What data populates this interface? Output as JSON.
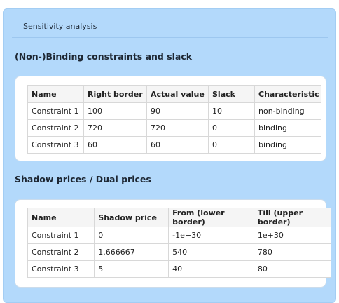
{
  "panel": {
    "title": "Sensitivity analysis"
  },
  "binding": {
    "title": "(Non-)Binding constraints and slack",
    "headers": [
      "Name",
      "Right border",
      "Actual value",
      "Slack",
      "Characteristic"
    ],
    "rows": [
      [
        "Constraint 1",
        "100",
        "90",
        "10",
        "non-binding"
      ],
      [
        "Constraint 2",
        "720",
        "720",
        "0",
        "binding"
      ],
      [
        "Constraint 3",
        "60",
        "60",
        "0",
        "binding"
      ]
    ]
  },
  "shadow": {
    "title": "Shadow prices / Dual prices",
    "headers": [
      "Name",
      "Shadow price",
      "From (lower border)",
      "Till (upper border)"
    ],
    "rows": [
      [
        "Constraint 1",
        "0",
        "-1e+30",
        "1e+30"
      ],
      [
        "Constraint 2",
        "1.666667",
        "540",
        "780"
      ],
      [
        "Constraint 3",
        "5",
        "40",
        "80"
      ]
    ]
  }
}
